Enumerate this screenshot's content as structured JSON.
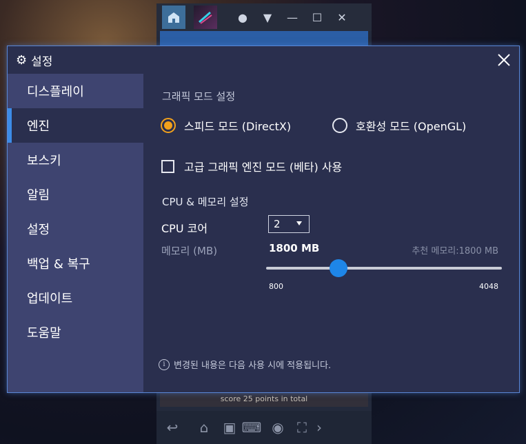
{
  "dialog": {
    "title": "설정",
    "close_icon": "close-icon",
    "gear_icon": "gear-icon"
  },
  "sidebar": {
    "items": [
      {
        "label": "디스플레이"
      },
      {
        "label": "엔진"
      },
      {
        "label": "보스키"
      },
      {
        "label": "알림"
      },
      {
        "label": "설정"
      },
      {
        "label": "백업 & 복구"
      },
      {
        "label": "업데이트"
      },
      {
        "label": "도움말"
      }
    ],
    "active_index": 1
  },
  "graphics": {
    "section_title": "그래픽 모드 설정",
    "option_speed": "스피드 모드 (DirectX)",
    "option_compat": "호환성 모드 (OpenGL)",
    "selected": "speed",
    "advanced_label": "고급 그래픽 엔진 모드 (베타) 사용",
    "advanced_checked": false
  },
  "cpu_memory": {
    "section_title": "CPU & 메모리 설정",
    "cpu_label": "CPU 코어",
    "cpu_value": "2",
    "memory_label": "메모리 (MB)",
    "memory_value": "1800 MB",
    "recommend_text": "추천 메모리:1800 MB",
    "slider_min": "800",
    "slider_max": "4048",
    "slider_value": 1800
  },
  "footer": {
    "info_text": "변경된 내용은 다음 사용 시에 적용됩니다."
  },
  "background": {
    "status_text": "score 25 points in total"
  },
  "colors": {
    "accent_blue": "#1e86e8",
    "radio_orange": "#f2a11c",
    "dialog_bg": "#2a2f4e",
    "sidebar_bg": "#3e4470"
  }
}
